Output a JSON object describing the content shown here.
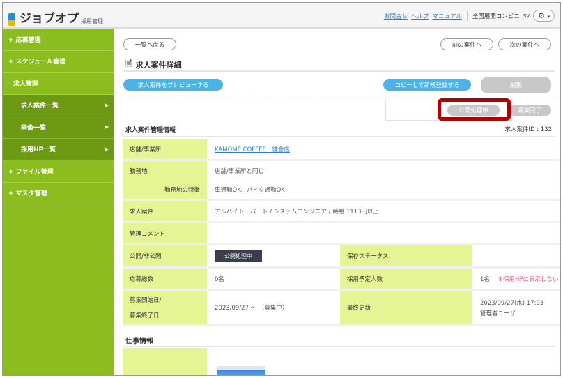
{
  "header": {
    "logo": "ジョブオプ",
    "logo_sub": "採用管理",
    "links": [
      "お問合せ",
      "ヘルプ",
      "マニュアル"
    ],
    "company": "全国展開コンビニ",
    "user": "SV"
  },
  "sidebar": {
    "items": [
      {
        "label": "+ 応募管理"
      },
      {
        "label": "+ スケジュール管理"
      },
      {
        "label": "- 求人管理"
      },
      {
        "label": "求人案件一覧"
      },
      {
        "label": "画像一覧"
      },
      {
        "label": "採用HP一覧"
      },
      {
        "label": "+ ファイル管理"
      },
      {
        "label": "+ マスタ管理"
      }
    ]
  },
  "main": {
    "back": "一覧へ戻る",
    "prev": "前の案件へ",
    "next": "次の案件へ",
    "title": "求人案件詳細",
    "preview": "求人案件をプレビューする",
    "copy": "コピーして新規登録する",
    "edit": "編集",
    "publishing": "公開処理中",
    "closed": "募集完了",
    "section": "求人案件管理情報",
    "job_id": "求人案件ID : 132",
    "rows": {
      "store": {
        "label": "店舗/事業所",
        "value": "KAMOME COFFEE　鎌倉店"
      },
      "location": {
        "label": "勤務地",
        "value": "店舗/事業所と同じ",
        "feature_label": "勤務地の特徴",
        "feature_value": "車通勤OK、バイク通勤OK"
      },
      "job": {
        "label": "求人案件",
        "value": "アルバイト・パート / システムエンジニア / 時給 1113円以上"
      },
      "comment": {
        "label": "管理コメント",
        "value": ""
      },
      "public": {
        "label": "公開/非公開",
        "value": "公開処理中",
        "label2": "保存ステータス",
        "value2": ""
      },
      "applies": {
        "label": "応募総数",
        "value": "0名",
        "label2": "採用予定人数",
        "value2": "1名",
        "note": "※採用HPに表示しない"
      },
      "period": {
        "label": "募集開始日/",
        "label_b": "募集終了日",
        "value": "2023/09/27 ～ （募集中）",
        "label2": "最終更新",
        "value2": "2023/09/27(水) 17:03",
        "value2_b": "管理者ユーザ"
      }
    },
    "work_section": "仕事情報"
  }
}
